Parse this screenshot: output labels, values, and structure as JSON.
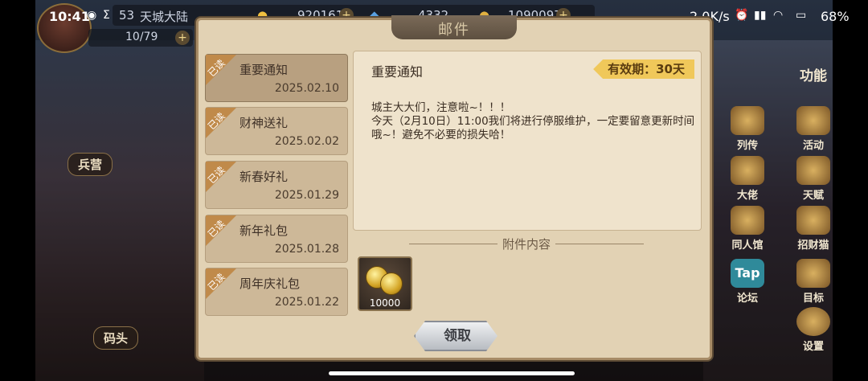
{
  "status_bar": {
    "time": "10:41",
    "network_speed": "2.0K/s",
    "battery": "68%"
  },
  "game_hud": {
    "level": "53",
    "location": "天城大陆",
    "resource_1": "920161",
    "resource_2": "4332",
    "resource_3": "1090097",
    "energy": "10/79",
    "left_buttons": [
      "兵营",
      "码头"
    ],
    "right_icons": [
      {
        "label": "列传",
        "icon": "book-icon"
      },
      {
        "label": "活动",
        "icon": "star-emblem-icon"
      },
      {
        "label": "大佬",
        "icon": "character-icon"
      },
      {
        "label": "天赋",
        "icon": "rank-emblem-icon"
      },
      {
        "label": "同人馆",
        "icon": "castle-icon"
      },
      {
        "label": "招财猫",
        "icon": "lucky-cat-icon"
      },
      {
        "label": "论坛",
        "icon": "tap-forum-icon",
        "badge": "Tap"
      },
      {
        "label": "目标",
        "icon": "target-scroll-icon"
      },
      {
        "label": "设置",
        "icon": "gear-icon"
      }
    ],
    "top_right_label": "功能"
  },
  "dialog": {
    "title": "邮件",
    "mails": [
      {
        "tag": "已读",
        "title": "重要通知",
        "date": "2025.02.10",
        "selected": true
      },
      {
        "tag": "已读",
        "title": "财神送礼",
        "date": "2025.02.02",
        "selected": false
      },
      {
        "tag": "已读",
        "title": "新春好礼",
        "date": "2025.01.29",
        "selected": false
      },
      {
        "tag": "已读",
        "title": "新年礼包",
        "date": "2025.01.28",
        "selected": false
      },
      {
        "tag": "已读",
        "title": "周年庆礼包",
        "date": "2025.01.22",
        "selected": false
      }
    ],
    "detail": {
      "title": "重要通知",
      "validity": "有效期：30天",
      "body": "城主大大们，注意啦~！！！\n今天（2月10日）11:00我们将进行停服维护，一定要留意更新时间哦~！避免不必要的损失哈！"
    },
    "attachment_header": "附件内容",
    "attachment": {
      "icon": "gold-coins-icon",
      "count": "10000"
    },
    "claim_button": "领取"
  }
}
